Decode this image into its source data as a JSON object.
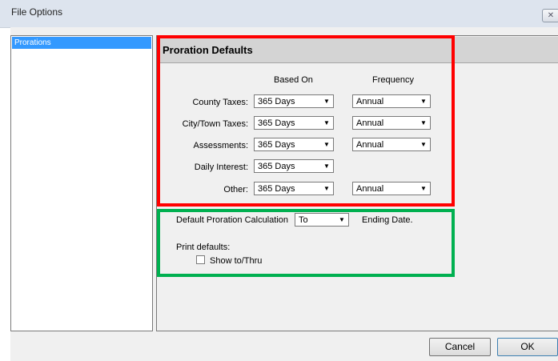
{
  "window": {
    "title": "File Options",
    "close_glyph": "✕"
  },
  "sidebar": {
    "items": [
      {
        "label": "Prorations",
        "selected": true
      }
    ]
  },
  "section": {
    "title": "Proration Defaults",
    "columns": {
      "based_on": "Based On",
      "frequency": "Frequency"
    },
    "rows": [
      {
        "label": "County Taxes:",
        "based_on": "365 Days",
        "frequency": "Annual"
      },
      {
        "label": "City/Town Taxes:",
        "based_on": "365 Days",
        "frequency": "Annual"
      },
      {
        "label": "Assessments:",
        "based_on": "365 Days",
        "frequency": "Annual"
      },
      {
        "label": "Daily Interest:",
        "based_on": "365 Days",
        "frequency": null
      },
      {
        "label": "Other:",
        "based_on": "365 Days",
        "frequency": "Annual"
      }
    ]
  },
  "calculation": {
    "label": "Default Proration Calculation",
    "value": "To",
    "suffix": "Ending Date.",
    "print_defaults_label": "Print defaults:",
    "show_to_thru_label": "Show to/Thru",
    "show_to_thru_checked": false
  },
  "buttons": {
    "cancel": "Cancel",
    "ok": "OK"
  },
  "icons": {
    "dropdown": "chevron-down-icon",
    "close": "close-icon"
  },
  "colors": {
    "highlight_red": "#ff0000",
    "highlight_green": "#00b050",
    "selection": "#3399ff"
  }
}
